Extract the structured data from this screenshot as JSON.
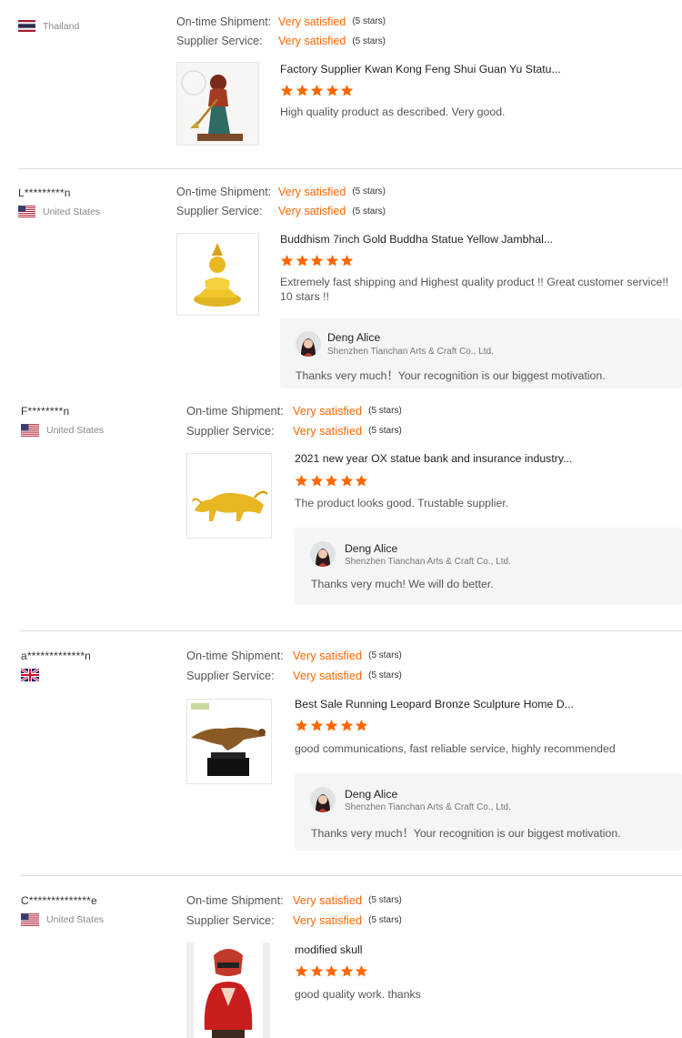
{
  "colors": {
    "accent": "#ff6600",
    "divider": "#dcdcdc",
    "reply_bg": "#f4f5f7"
  },
  "rating_labels": {
    "shipment": "On-time Shipment:",
    "service": "Supplier Service:"
  },
  "reviews": [
    {
      "user": "",
      "country": "Thailand",
      "flag": "thailand-flag",
      "shipment_value": "Very satisfied",
      "shipment_stars": "(5 stars)",
      "service_value": "Very satisfied",
      "service_stars": "(5 stars)",
      "product_title": "Factory Supplier Kwan Kong Feng Shui Guan Yu Statu...",
      "product_image": "guan-yu-statue-image",
      "rating": 5,
      "comment": "High quality product as described. Very good."
    },
    {
      "user": "L*********n",
      "country": "United States",
      "flag": "us-flag",
      "shipment_value": "Very satisfied",
      "shipment_stars": "(5 stars)",
      "service_value": "Very satisfied",
      "service_stars": "(5 stars)",
      "product_title": "Buddhism 7inch Gold Buddha Statue Yellow Jambhal...",
      "product_image": "gold-buddha-statue-image",
      "rating": 5,
      "comment": "Extremely fast shipping and Highest quality product !! Great customer service!! 10 stars !!",
      "reply": {
        "name": "Deng Alice",
        "company": "Shenzhen Tianchan Arts & Craft Co., Ltd.",
        "text": "Thanks very much！Your recognition is our biggest motivation."
      }
    },
    {
      "user": "F********n",
      "country": "United States",
      "flag": "us-flag",
      "shipment_value": "Very satisfied",
      "shipment_stars": "(5 stars)",
      "service_value": "Very satisfied",
      "service_stars": "(5 stars)",
      "product_title": "2021 new year OX statue bank and insurance industry...",
      "product_image": "gold-ox-statue-image",
      "rating": 5,
      "comment": "The product looks good. Trustable supplier.",
      "reply": {
        "name": "Deng Alice",
        "company": "Shenzhen Tianchan Arts & Craft Co., Ltd.",
        "text": "Thanks very much! We will do better."
      }
    },
    {
      "user": "a*************n",
      "country": "",
      "flag": "uk-flag",
      "shipment_value": "Very satisfied",
      "shipment_stars": "(5 stars)",
      "service_value": "Very satisfied",
      "service_stars": "(5 stars)",
      "product_title": "Best Sale Running Leopard Bronze Sculpture Home D...",
      "product_image": "leopard-sculpture-image",
      "rating": 5,
      "comment": "good communications, fast reliable service, highly recommended",
      "reply": {
        "name": "Deng Alice",
        "company": "Shenzhen Tianchan Arts & Craft Co., Ltd.",
        "text": "Thanks very much！Your recognition is our biggest motivation."
      }
    },
    {
      "user": "C**************e",
      "country": "United States",
      "flag": "us-flag",
      "shipment_value": "Very satisfied",
      "shipment_stars": "(5 stars)",
      "service_value": "Very satisfied",
      "service_stars": "(5 stars)",
      "product_title": "modified skull",
      "product_image": "skull-bust-image",
      "rating": 5,
      "comment": "good quality work. thanks"
    }
  ]
}
